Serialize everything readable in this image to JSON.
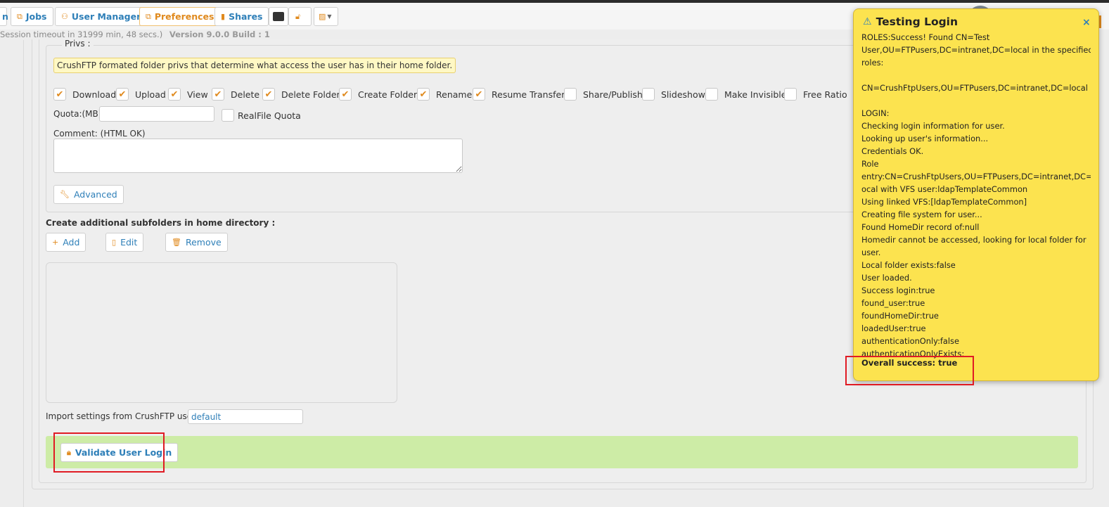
{
  "toolbar": {
    "partial_label": "n",
    "jobs": "Jobs",
    "user_manager": "User Manager",
    "preferences": "Preferences",
    "shares": "Shares"
  },
  "status": {
    "session": "Session timeout in 31999 min, 48 secs.)",
    "version": "Version 9.0.0 Build : 1"
  },
  "privs": {
    "legend": "Privs :",
    "note": "CrushFTP formated folder privs that determine what access the user has in their home folder.",
    "items": [
      {
        "label": "Download",
        "checked": true
      },
      {
        "label": "Upload",
        "checked": true
      },
      {
        "label": "View",
        "checked": true
      },
      {
        "label": "Delete",
        "checked": true
      },
      {
        "label": "Delete Folder",
        "checked": true
      },
      {
        "label": "Create Folder",
        "checked": true
      },
      {
        "label": "Rename",
        "checked": true
      },
      {
        "label": "Resume Transfers",
        "checked": true
      },
      {
        "label": "Share/Publish",
        "checked": false
      },
      {
        "label": "Slideshow",
        "checked": false
      },
      {
        "label": "Make Invisible",
        "checked": false
      },
      {
        "label": "Free Ratio",
        "checked": false
      }
    ],
    "check_glyph": "✔",
    "quota_label": "Quota:(MB)",
    "quota_value": "",
    "realfile_label": "RealFile Quota",
    "comment_label": "Comment: (HTML OK)",
    "comment_value": "",
    "advanced_label": "Advanced"
  },
  "subfolders": {
    "label": "Create additional subfolders in home directory :",
    "add": "Add",
    "edit": "Edit",
    "remove": "Remove"
  },
  "import": {
    "label": "Import settings from CrushFTP user :",
    "value": "default"
  },
  "validate": {
    "label": "Validate User Login"
  },
  "popup": {
    "title": "Testing Login",
    "close": "×",
    "lines": [
      "ROLES:Success! Found CN=Test",
      "User,OU=FTPusers,DC=intranet,DC=local in the specified",
      "roles:",
      "",
      "CN=CrushFtpUsers,OU=FTPusers,DC=intranet,DC=local",
      "",
      "LOGIN:",
      "Checking login information for user.",
      "Looking up user's information...",
      "Credentials OK.",
      "Role",
      "entry:CN=CrushFtpUsers,OU=FTPusers,DC=intranet,DC=l",
      "ocal with VFS user:ldapTemplateCommon",
      "Using linked VFS:[ldapTemplateCommon]",
      "Creating file system for user...",
      "Found HomeDir record of:null",
      "Homedir cannot be accessed, looking for local folder for",
      "user.",
      "Local folder exists:false",
      "User loaded.",
      "Success login:true",
      "found_user:true",
      "foundHomeDir:true",
      "loadedUser:true",
      "authenticationOnly:false",
      "authenticationOnlyExists:"
    ],
    "final": "Overall success: true"
  },
  "colors": {
    "accent": "#e08a1e",
    "link": "#2e7fb8",
    "popup_bg": "#fce34f",
    "success_bar": "#cdeca6",
    "highlight_box": "#e01b24"
  }
}
